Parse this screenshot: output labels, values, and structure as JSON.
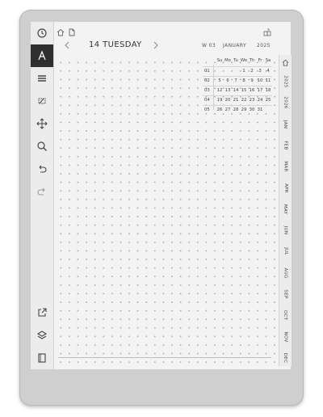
{
  "header": {
    "date_title": "14 TUESDAY",
    "week": "W 03",
    "month": "JANUARY",
    "year": "2025"
  },
  "calendar": {
    "weekdays": [
      "Su",
      "Mo",
      "Tu",
      "We",
      "Th",
      "Fr",
      "Sa"
    ],
    "weeks": [
      {
        "num": "01",
        "days": [
          "",
          "",
          "",
          "1",
          "2",
          "3",
          "4"
        ]
      },
      {
        "num": "02",
        "days": [
          "5",
          "6",
          "7",
          "8",
          "9",
          "10",
          "11"
        ]
      },
      {
        "num": "03",
        "days": [
          "12",
          "13",
          "14",
          "15",
          "16",
          "17",
          "18"
        ]
      },
      {
        "num": "04",
        "days": [
          "19",
          "20",
          "21",
          "22",
          "23",
          "24",
          "25"
        ]
      },
      {
        "num": "05",
        "days": [
          "26",
          "27",
          "28",
          "29",
          "30",
          "31",
          ""
        ]
      }
    ]
  },
  "right_tabs": [
    "2025",
    "2026",
    "JAN",
    "FEB",
    "MAR",
    "APR",
    "MAY",
    "JUN",
    "JUL",
    "AUG",
    "SEP",
    "OCT",
    "NOV",
    "DEC"
  ],
  "tools": [
    {
      "name": "clock-icon",
      "active": false
    },
    {
      "name": "pen-icon",
      "active": true
    },
    {
      "name": "menu-lines-icon",
      "active": false
    },
    {
      "name": "eraser-icon",
      "active": false
    },
    {
      "name": "move-icon",
      "active": false
    },
    {
      "name": "zoom-icon",
      "active": false
    },
    {
      "name": "undo-icon",
      "active": false
    },
    {
      "name": "redo-icon",
      "active": false
    }
  ],
  "bottom_tools": [
    "share-icon",
    "layers-icon",
    "page-icon"
  ]
}
